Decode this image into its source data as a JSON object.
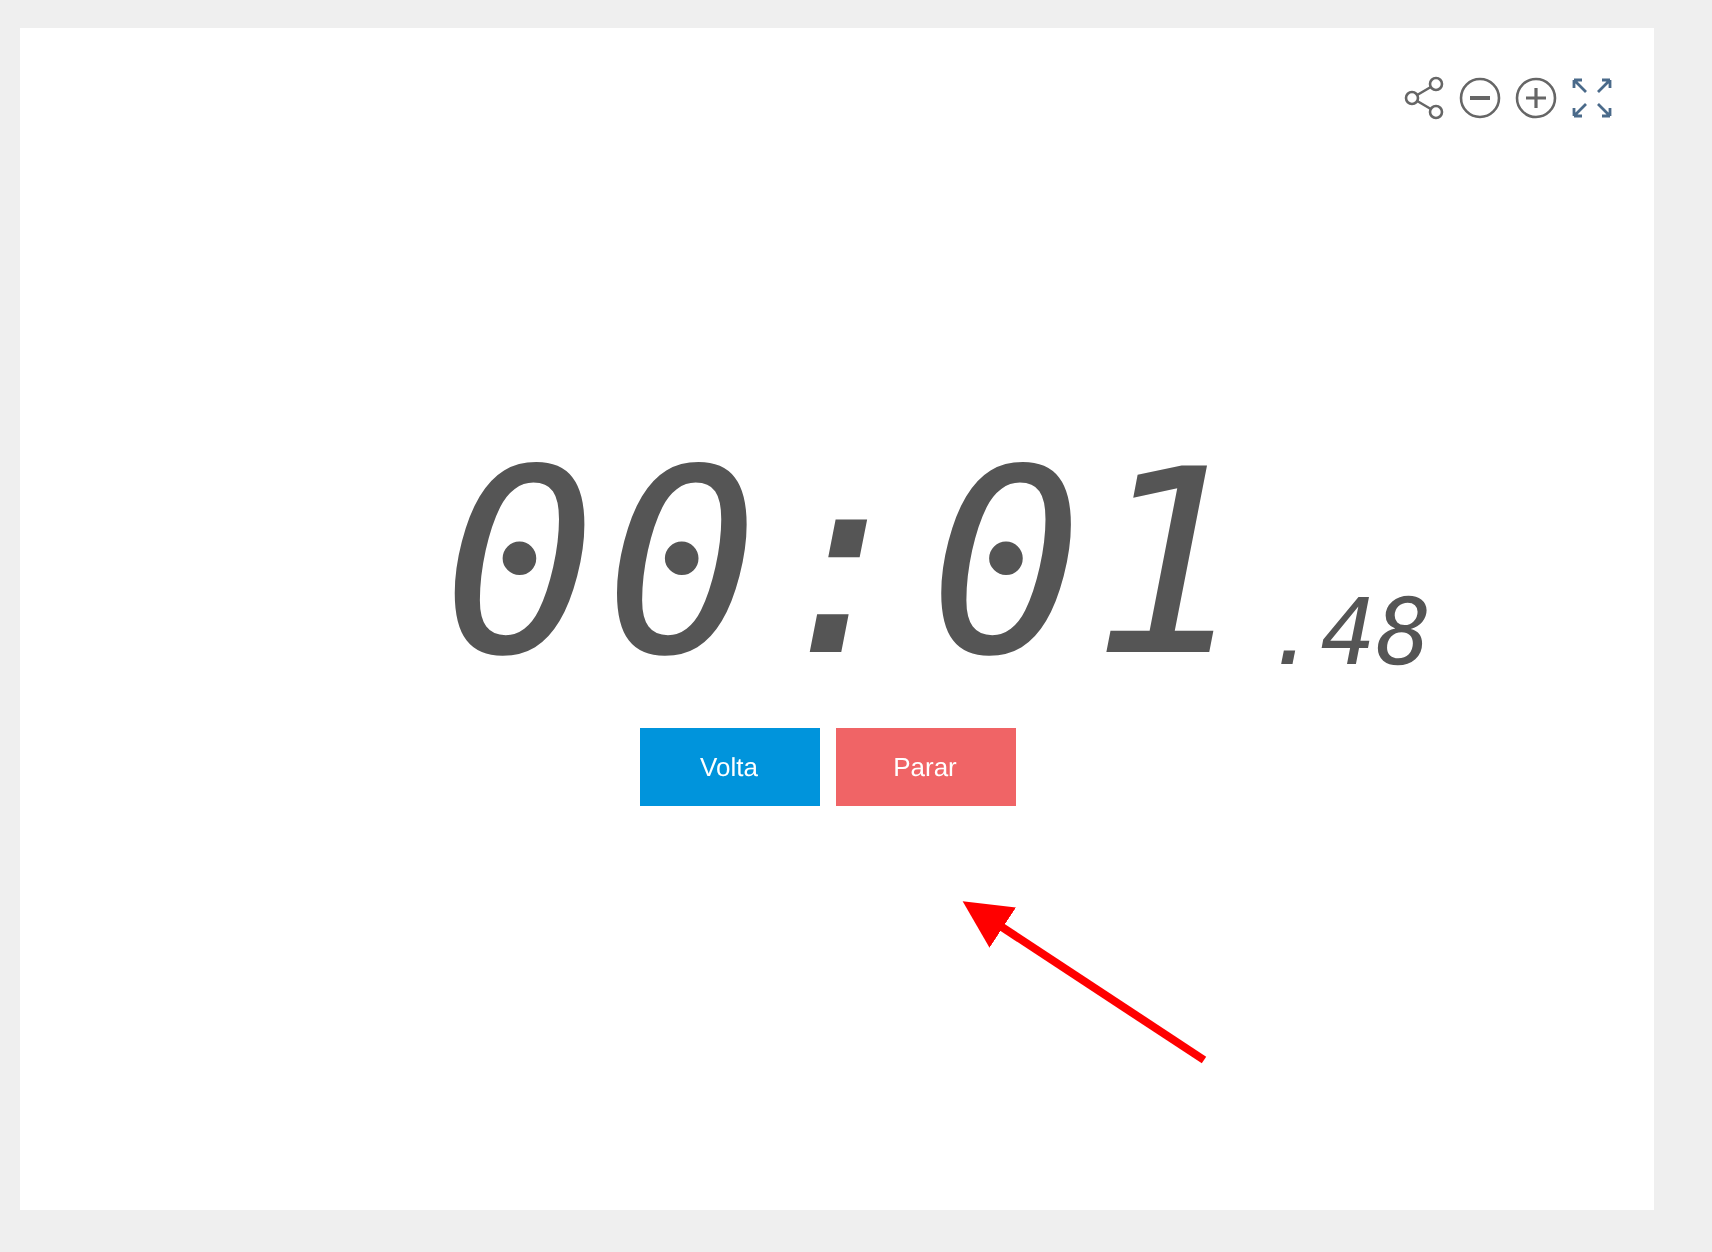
{
  "clock": {
    "main": "00:01",
    "fraction": ".48"
  },
  "buttons": [
    {
      "label": "Volta",
      "kind": "lap"
    },
    {
      "label": "Parar",
      "kind": "stop"
    }
  ]
}
